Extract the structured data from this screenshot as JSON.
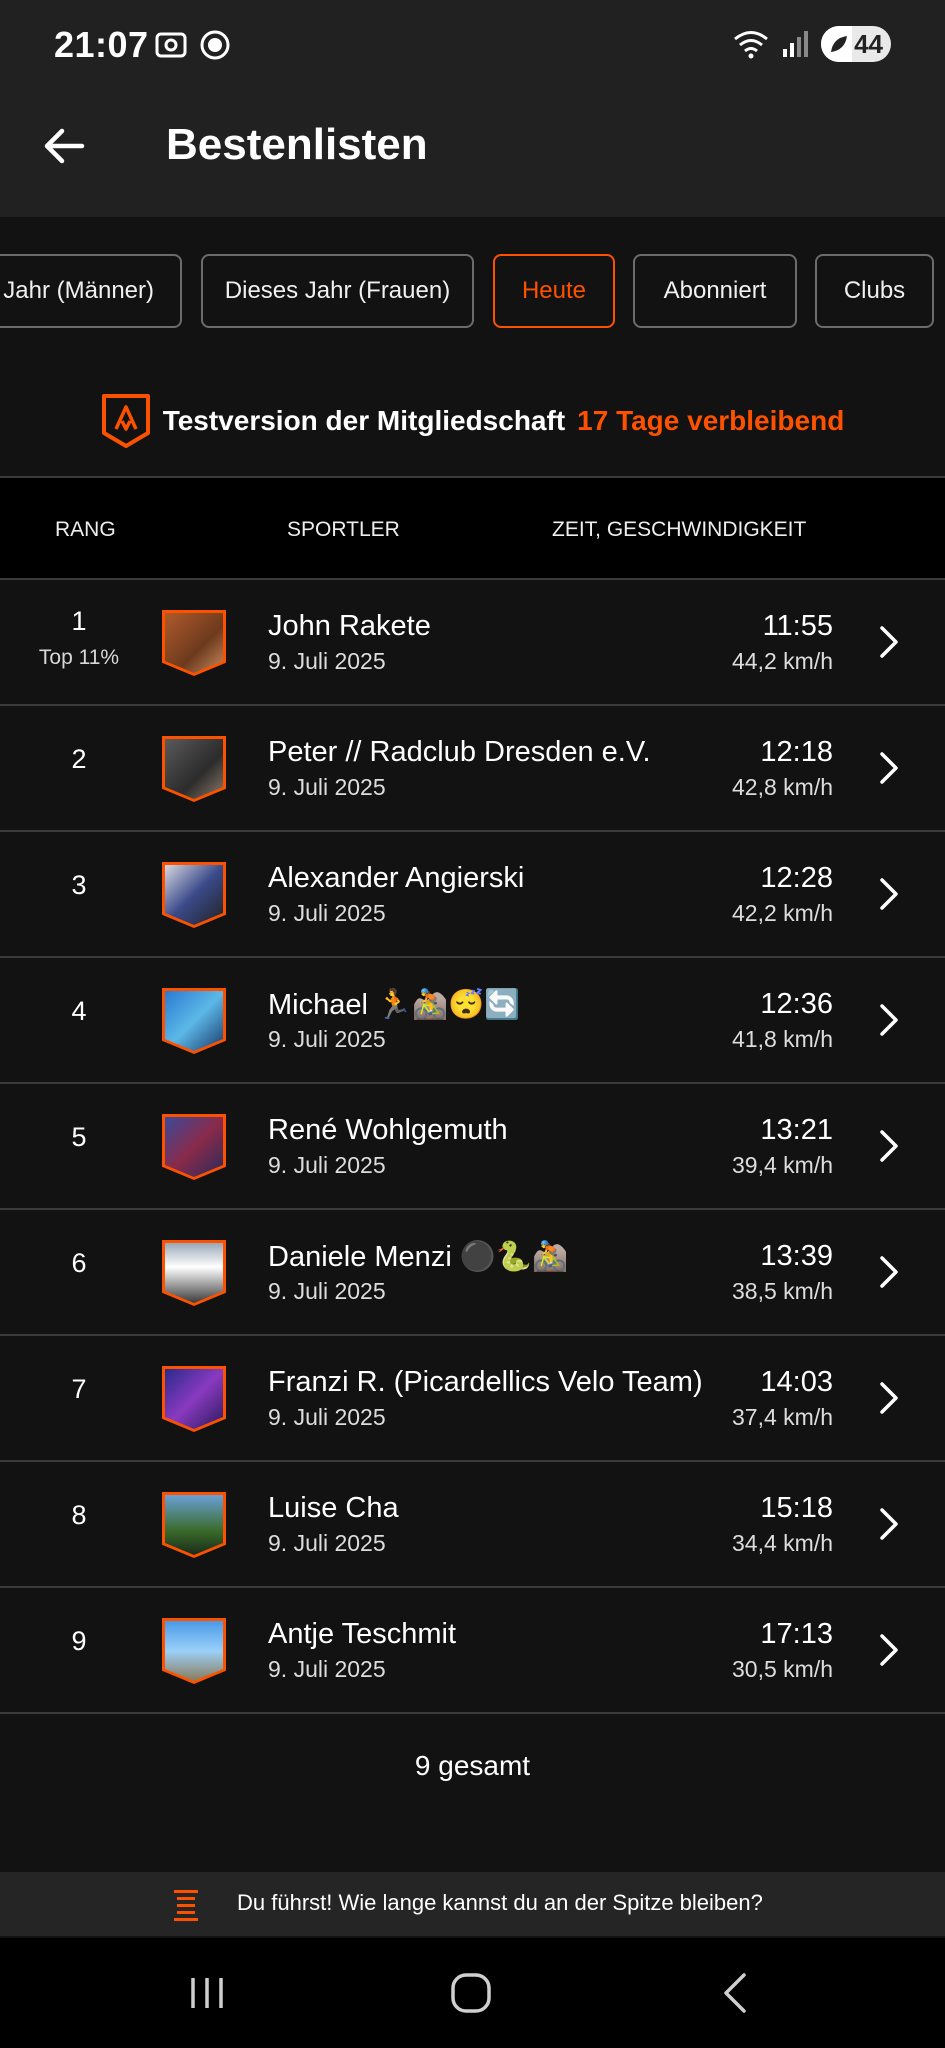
{
  "status": {
    "time": "21:07",
    "battery": "44",
    "battery_level": 0.44
  },
  "header": {
    "title": "Bestenlisten"
  },
  "tabs": [
    {
      "label": "s Jahr (Männer)",
      "active": false
    },
    {
      "label": "Dieses Jahr (Frauen)",
      "active": false
    },
    {
      "label": "Heute",
      "active": true
    },
    {
      "label": "Abonniert",
      "active": false
    },
    {
      "label": "Clubs",
      "active": false
    }
  ],
  "trial": {
    "text": "Testversion der Mitgliedschaft",
    "remaining": "17 Tage verbleibend"
  },
  "table": {
    "headers": {
      "rank": "RANG",
      "athlete": "SPORTLER",
      "time": "ZEIT, GESCHWINDIGKEIT"
    },
    "rows": [
      {
        "rank": "1",
        "rank_sub": "Top 11%",
        "name": "John Rakete",
        "date": "9. Juli 2025",
        "time": "11:55",
        "speed": "44,2 km/h"
      },
      {
        "rank": "2",
        "rank_sub": "",
        "name": "Peter // Radclub Dresden e.V.",
        "date": "9. Juli 2025",
        "time": "12:18",
        "speed": "42,8 km/h"
      },
      {
        "rank": "3",
        "rank_sub": "",
        "name": "Alexander Angierski",
        "date": "9. Juli 2025",
        "time": "12:28",
        "speed": "42,2 km/h"
      },
      {
        "rank": "4",
        "rank_sub": "",
        "name": "Michael 🏃🚵😴🔄",
        "date": "9. Juli 2025",
        "time": "12:36",
        "speed": "41,8 km/h"
      },
      {
        "rank": "5",
        "rank_sub": "",
        "name": "René Wohlgemuth",
        "date": "9. Juli 2025",
        "time": "13:21",
        "speed": "39,4 km/h"
      },
      {
        "rank": "6",
        "rank_sub": "",
        "name": "Daniele Menzi ⚫🐍🚵",
        "date": "9. Juli 2025",
        "time": "13:39",
        "speed": "38,5 km/h"
      },
      {
        "rank": "7",
        "rank_sub": "",
        "name": "Franzi R.  (Picardellics Velo Team)",
        "date": "9. Juli 2025",
        "time": "14:03",
        "speed": "37,4 km/h"
      },
      {
        "rank": "8",
        "rank_sub": "",
        "name": "Luise Cha",
        "date": "9. Juli 2025",
        "time": "15:18",
        "speed": "34,4 km/h"
      },
      {
        "rank": "9",
        "rank_sub": "",
        "name": "Antje Teschmit",
        "date": "9. Juli 2025",
        "time": "17:13",
        "speed": "30,5 km/h"
      }
    ],
    "total": "9 gesamt"
  },
  "banner": {
    "message": "Du führst! Wie lange kannst du an der Spitze bleiben?"
  },
  "colors": {
    "accent": "#fc5200",
    "background": "#121212",
    "bar": "#212121"
  },
  "icons": {
    "back": "arrow-left-icon",
    "row_chevron": "chevron-right-icon",
    "trial": "strava-badge-icon",
    "banner": "leaderboard-icon"
  }
}
